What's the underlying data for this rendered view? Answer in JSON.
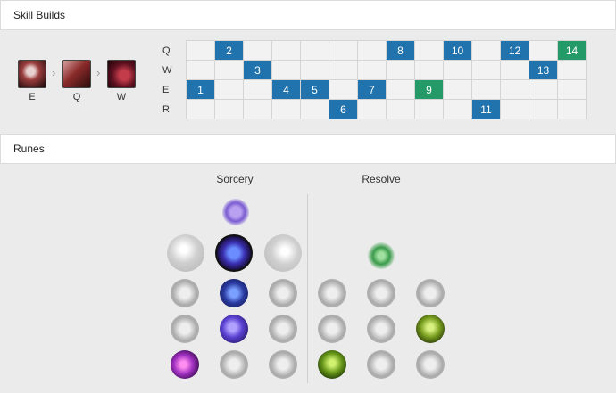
{
  "skill_builds": {
    "title": "Skill Builds",
    "sequence": [
      {
        "key": "E",
        "color": "#9a3d3d"
      },
      {
        "key": "Q",
        "color": "#8a2a2a"
      },
      {
        "key": "W",
        "color": "#7a2030"
      }
    ],
    "arrow": "›",
    "rows": [
      {
        "label": "Q",
        "cells": [
          "",
          "2",
          "",
          "",
          "",
          "",
          "",
          "8",
          "",
          "10",
          "",
          "12",
          "",
          "14"
        ]
      },
      {
        "label": "W",
        "cells": [
          "",
          "",
          "3",
          "",
          "",
          "",
          "",
          "",
          "",
          "",
          "",
          "",
          "13",
          ""
        ]
      },
      {
        "label": "E",
        "cells": [
          "1",
          "",
          "",
          "4",
          "5",
          "",
          "7",
          "",
          "9",
          "",
          "",
          "",
          "",
          ""
        ]
      },
      {
        "label": "R",
        "cells": [
          "",
          "",
          "",
          "",
          "",
          "6",
          "",
          "",
          "",
          "",
          "11",
          "",
          "",
          ""
        ]
      }
    ],
    "highlight_levels": [
      "9",
      "14"
    ],
    "colors": {
      "normal": "#2173ae",
      "highlight": "#239a68"
    }
  },
  "runes": {
    "title": "Runes",
    "primary": {
      "name": "Sorcery"
    },
    "secondary": {
      "name": "Resolve"
    }
  }
}
